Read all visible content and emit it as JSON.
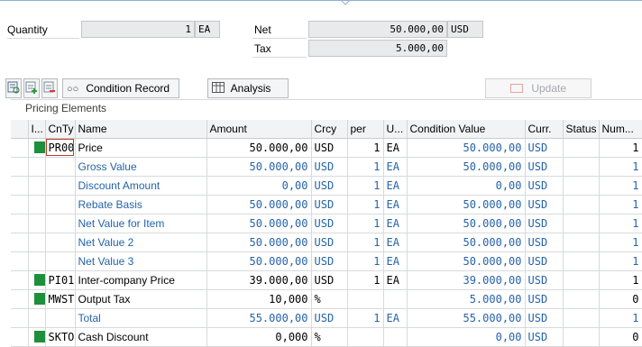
{
  "header": {
    "quantity_label": "Quantity",
    "quantity_value": "1",
    "quantity_unit": "EA",
    "net_label": "Net",
    "net_value": "50.000,00",
    "net_currency": "USD",
    "tax_label": "Tax",
    "tax_value": "5.000,00"
  },
  "toolbar": {
    "condition_record_label": "Condition Record",
    "analysis_label": "Analysis",
    "update_label": "Update"
  },
  "panel": {
    "title": "Pricing Elements",
    "columns": [
      "I...",
      "CnTy",
      "Name",
      "Amount",
      "Crcy",
      "per",
      "U...",
      "Condition Value",
      "Curr.",
      "Status",
      "Num..."
    ],
    "rows": [
      {
        "status": "green",
        "cnty": "PR00",
        "name": "Price",
        "amount": "50.000,00",
        "crcy": "USD",
        "per": "1",
        "uom": "EA",
        "cond_value": "50.000,00",
        "curr": "USD",
        "status_text": "",
        "num": "1",
        "style": "normal"
      },
      {
        "status": "",
        "cnty": "",
        "name": "Gross Value",
        "amount": "50.000,00",
        "crcy": "USD",
        "per": "1",
        "uom": "EA",
        "cond_value": "50.000,00",
        "curr": "USD",
        "status_text": "",
        "num": "1",
        "style": "blue"
      },
      {
        "status": "",
        "cnty": "",
        "name": "Discount Amount",
        "amount": "0,00",
        "crcy": "USD",
        "per": "1",
        "uom": "EA",
        "cond_value": "0,00",
        "curr": "USD",
        "status_text": "",
        "num": "1",
        "style": "blue"
      },
      {
        "status": "",
        "cnty": "",
        "name": "Rebate Basis",
        "amount": "50.000,00",
        "crcy": "USD",
        "per": "1",
        "uom": "EA",
        "cond_value": "50.000,00",
        "curr": "USD",
        "status_text": "",
        "num": "1",
        "style": "blue"
      },
      {
        "status": "",
        "cnty": "",
        "name": "Net Value for Item",
        "amount": "50.000,00",
        "crcy": "USD",
        "per": "1",
        "uom": "EA",
        "cond_value": "50.000,00",
        "curr": "USD",
        "status_text": "",
        "num": "1",
        "style": "blue"
      },
      {
        "status": "",
        "cnty": "",
        "name": "Net Value 2",
        "amount": "50.000,00",
        "crcy": "USD",
        "per": "1",
        "uom": "EA",
        "cond_value": "50.000,00",
        "curr": "USD",
        "status_text": "",
        "num": "1",
        "style": "blue"
      },
      {
        "status": "",
        "cnty": "",
        "name": "Net Value 3",
        "amount": "50.000,00",
        "crcy": "USD",
        "per": "1",
        "uom": "EA",
        "cond_value": "50.000,00",
        "curr": "USD",
        "status_text": "",
        "num": "1",
        "style": "blue"
      },
      {
        "status": "green",
        "cnty": "PI01",
        "name": "Inter-company Price",
        "amount": "39.000,00",
        "crcy": "USD",
        "per": "1",
        "uom": "EA",
        "cond_value": "39.000,00",
        "curr": "USD",
        "status_text": "",
        "num": "1",
        "style": "normal"
      },
      {
        "status": "green",
        "cnty": "MWST",
        "name": "Output Tax",
        "amount": "10,000",
        "crcy": "%",
        "per": "",
        "uom": "",
        "cond_value": "5.000,00",
        "curr": "USD",
        "status_text": "",
        "num": "0",
        "style": "tax"
      },
      {
        "status": "",
        "cnty": "",
        "name": "Total",
        "amount": "55.000,00",
        "crcy": "USD",
        "per": "1",
        "uom": "EA",
        "cond_value": "55.000,00",
        "curr": "USD",
        "status_text": "",
        "num": "1",
        "style": "blue"
      },
      {
        "status": "green",
        "cnty": "SKTO",
        "name": "Cash Discount",
        "amount": "0,000",
        "crcy": "%",
        "per": "",
        "uom": "",
        "cond_value": "0,00",
        "curr": "USD",
        "status_text": "",
        "num": "0",
        "style": "tax"
      }
    ]
  },
  "colors": {
    "status_green": "#1e8f3c",
    "value_blue": "#2563a9",
    "field_bg": "#e9eaeb"
  }
}
